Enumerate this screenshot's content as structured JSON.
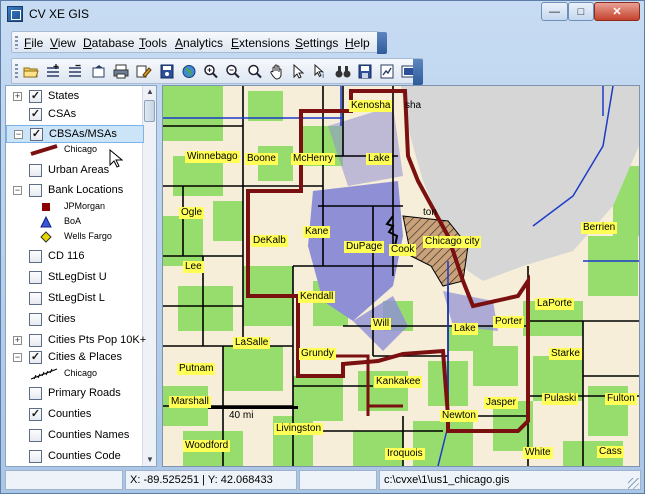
{
  "window": {
    "title": "CV XE GIS",
    "controls": {
      "minimize": "—",
      "maximize": "□",
      "close": "✕"
    }
  },
  "menu": {
    "items": [
      {
        "label": "File",
        "ul": "F",
        "rest": "ile"
      },
      {
        "label": "View",
        "ul": "V",
        "rest": "iew"
      },
      {
        "label": "Database",
        "ul": "D",
        "rest": "atabase"
      },
      {
        "label": "Tools",
        "ul": "T",
        "rest": "ools"
      },
      {
        "label": "Analytics",
        "ul": "A",
        "rest": "nalytics"
      },
      {
        "label": "Extensions",
        "ul": "E",
        "rest": "xtensions"
      },
      {
        "label": "Settings",
        "ul": "S",
        "rest": "ettings"
      },
      {
        "label": "Help",
        "ul": "H",
        "rest": "elp"
      }
    ]
  },
  "toolbar": {
    "tools": [
      "open-folder-icon",
      "add-layer-icon",
      "remove-layer-icon",
      "export-icon",
      "print-icon",
      "edit-icon",
      "save-map-icon",
      "globe-icon",
      "zoom-in-icon",
      "zoom-out-icon",
      "zoom-box-icon",
      "pan-hand-icon",
      "select-arrow-icon",
      "identify-icon",
      "find-binoculars-icon",
      "save-icon",
      "properties-icon",
      "full-extent-icon"
    ]
  },
  "layers": [
    {
      "label": "States",
      "checked": true,
      "expander": "+"
    },
    {
      "label": "CSAs",
      "checked": true,
      "expander": ""
    },
    {
      "label": "CBSAs/MSAs",
      "checked": true,
      "expander": "−",
      "selected": true
    },
    {
      "label": "Urban Areas",
      "checked": false,
      "expander": ""
    },
    {
      "label": "Bank Locations",
      "checked": false,
      "expander": "−"
    },
    {
      "label": "CD 116",
      "checked": false,
      "expander": ""
    },
    {
      "label": "StLegDist U",
      "checked": false,
      "expander": ""
    },
    {
      "label": "StLegDist L",
      "checked": false,
      "expander": ""
    },
    {
      "label": "Cities",
      "checked": false,
      "expander": ""
    },
    {
      "label": "Cities Pts Pop 10K+",
      "checked": false,
      "expander": "+"
    },
    {
      "label": "Cities & Places",
      "checked": true,
      "expander": "−"
    },
    {
      "label": "Primary Roads",
      "checked": false,
      "expander": ""
    },
    {
      "label": "Counties",
      "checked": true,
      "expander": ""
    },
    {
      "label": "Counties Names",
      "checked": false,
      "expander": ""
    },
    {
      "label": "Counties Code",
      "checked": false,
      "expander": ""
    }
  ],
  "legend": {
    "cbsa": {
      "label": "Chicago",
      "color": "#7a1010"
    },
    "banks": [
      {
        "label": "JPMorgan",
        "color": "#8b0000",
        "shape": "square"
      },
      {
        "label": "BoA",
        "color": "#3b55d9",
        "shape": "triangle"
      },
      {
        "label": "Wells Fargo",
        "color": "#e5d800",
        "shape": "diamond"
      }
    ],
    "places": {
      "label": "Chicago"
    }
  },
  "map": {
    "colors": {
      "lake": "#d6d6d6",
      "land": "#f6eed8",
      "green": "#96dd6e",
      "purple": "#8f8fd6",
      "cbsa": "#7a1010",
      "county": "#000000",
      "state": "#1c3bcc"
    },
    "county_labels": [
      "Kenosha",
      "Winnebago",
      "Boone",
      "McHenry",
      "Lake",
      "Ogle",
      "DeKalb",
      "Kane",
      "DuPage",
      "Cook",
      "Chicago city",
      "Berrien",
      "Lee",
      "Kendall",
      "Will",
      "LaPorte",
      "Porter",
      "Lake",
      "LaSalle",
      "Grundy",
      "Starke",
      "Putnam",
      "Kankakee",
      "Marshall",
      "Pulaski",
      "Fulton",
      "Jasper",
      "Newton",
      "Livingston",
      "Woodford",
      "Iroquois",
      "White",
      "Cass"
    ],
    "plain_labels": [
      "sha",
      "ton"
    ],
    "scale": "40 mi"
  },
  "status": {
    "coords": "X: -89.525251 | Y: 42.068433",
    "path": "c:\\cvxe\\1\\us1_chicago.gis"
  }
}
